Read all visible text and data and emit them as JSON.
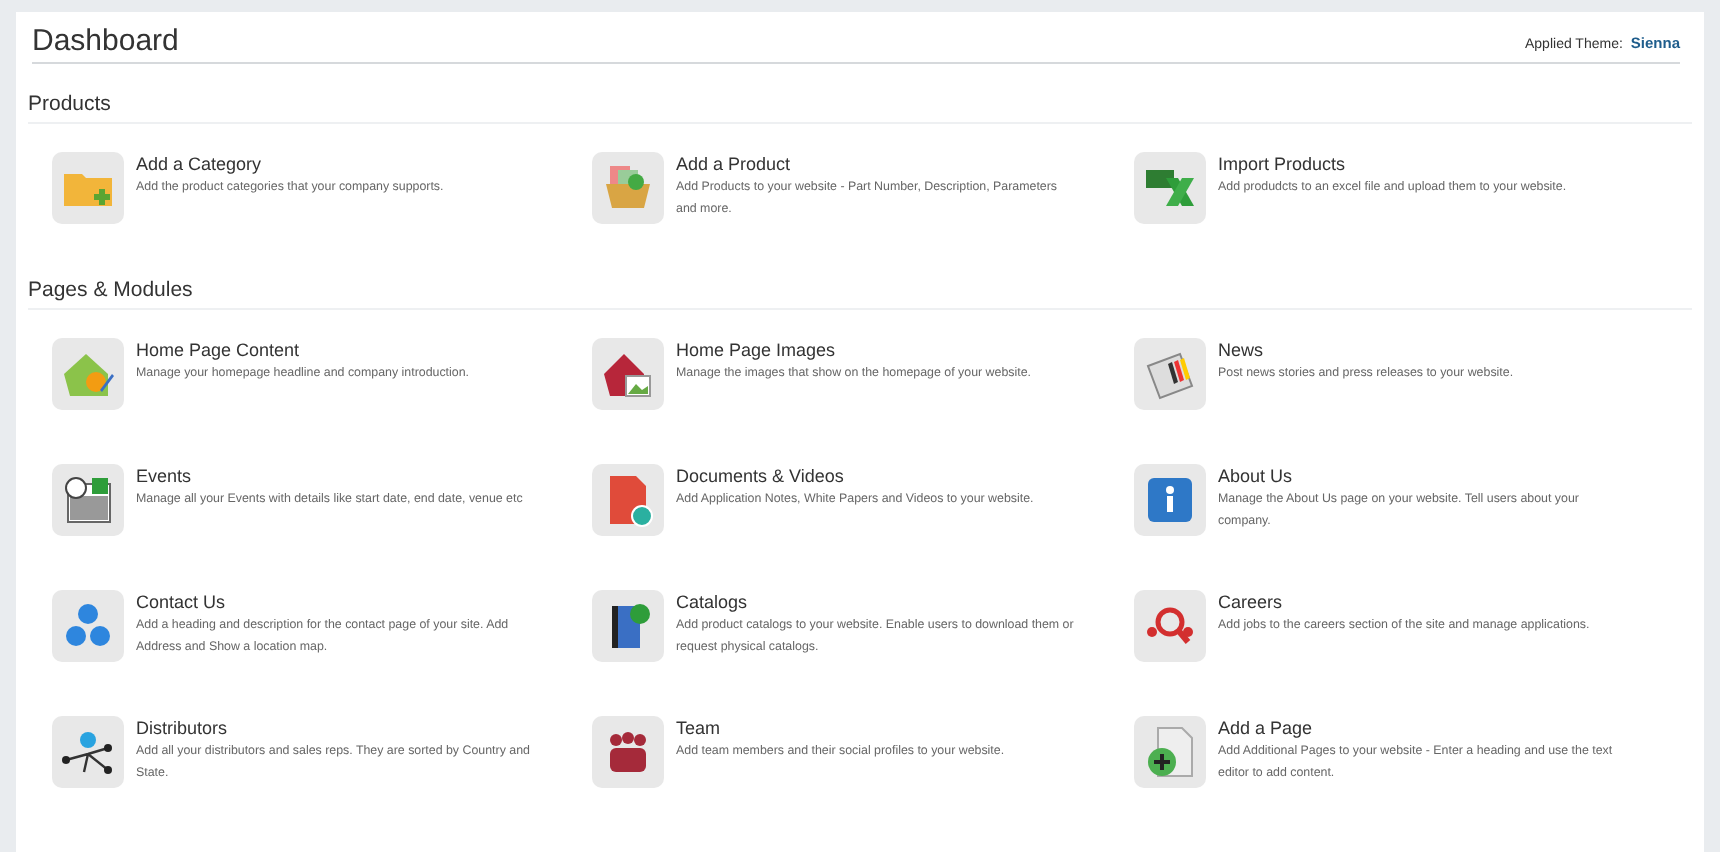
{
  "header": {
    "title": "Dashboard",
    "theme_label": "Applied Theme:",
    "theme_name": "Sienna"
  },
  "sections": [
    {
      "title": "Products",
      "items": [
        {
          "kind": "folder",
          "title": "Add a Category",
          "description": "Add the product categories that your company supports."
        },
        {
          "kind": "box",
          "title": "Add a Product",
          "description": "Add Products to your website - Part Number, Description, Parameters and more."
        },
        {
          "kind": "excel",
          "title": "Import Products",
          "description": "Add produdcts to an excel file and upload them to your website."
        }
      ]
    },
    {
      "title": "Pages & Modules",
      "items": [
        {
          "kind": "home",
          "title": "Home Page Content",
          "description": "Manage your homepage headline and company introduction."
        },
        {
          "kind": "house-image",
          "title": "Home Page Images",
          "description": "Manage the images that show on the homepage of your website."
        },
        {
          "kind": "news",
          "title": "News",
          "description": "Post news stories and press releases to your website."
        },
        {
          "kind": "calendar",
          "title": "Events",
          "description": "Manage all your Events with details like start date, end date, venue etc"
        },
        {
          "kind": "pdf",
          "title": "Documents & Videos",
          "description": "Add Application Notes, White Papers and Videos to your website."
        },
        {
          "kind": "info",
          "title": "About Us",
          "description": "Manage the About Us page on your website. Tell users about your company."
        },
        {
          "kind": "contact",
          "title": "Contact Us",
          "description": "Add a heading and description for the contact page of your site. Add Address and Show a location map."
        },
        {
          "kind": "book",
          "title": "Catalogs",
          "description": "Add product catalogs to your website. Enable users to download them or request physical catalogs."
        },
        {
          "kind": "careers",
          "title": "Careers",
          "description": "Add jobs to the careers section of the site and manage applications."
        },
        {
          "kind": "network",
          "title": "Distributors",
          "description": "Add all your distributors and sales reps. They are sorted by Country and State."
        },
        {
          "kind": "team",
          "title": "Team",
          "description": "Add team members and their social profiles to your website."
        },
        {
          "kind": "page",
          "title": "Add a Page",
          "description": "Add Additional Pages to your website - Enter a heading and use the text editor to add content."
        }
      ]
    }
  ]
}
